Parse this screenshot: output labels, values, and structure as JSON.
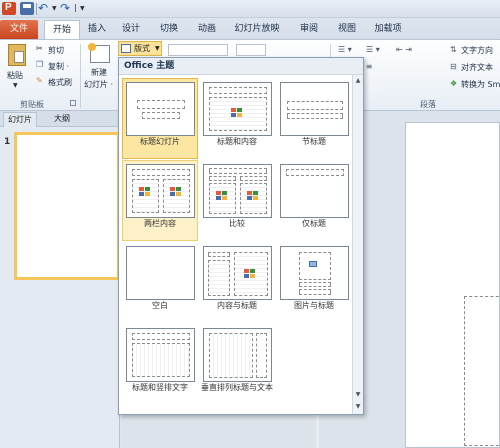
{
  "quick_access": {
    "separator": "|"
  },
  "tabs": [
    "文件",
    "开始",
    "插入",
    "设计",
    "切换",
    "动画",
    "幻灯片放映",
    "审阅",
    "视图",
    "加载项"
  ],
  "ribbon": {
    "paste": "粘贴",
    "cut": "剪切",
    "copy": "复制 ·",
    "format_painter": "格式刷",
    "clipboard_group": "剪贴板",
    "new_slide_line1": "新建",
    "new_slide_line2": "幻灯片 ·",
    "layout_btn": "版式",
    "paragraph_group": "段落",
    "text_direction": "文字方向",
    "align_text": "对齐文本",
    "convert_smartart": "转换为 Sm"
  },
  "thumbs_pane": {
    "tab_slides": "幻灯片",
    "tab_outline": "大纲",
    "slide_number": "1"
  },
  "gallery": {
    "header": "Office 主题",
    "layouts": [
      {
        "label": "标题幻灯片",
        "state": "selected"
      },
      {
        "label": "标题和内容",
        "state": "normal"
      },
      {
        "label": "节标题",
        "state": "normal"
      },
      {
        "label": "两栏内容",
        "state": "hover"
      },
      {
        "label": "比较",
        "state": "normal"
      },
      {
        "label": "仅标题",
        "state": "normal"
      },
      {
        "label": "空白",
        "state": "normal"
      },
      {
        "label": "内容与标题",
        "state": "normal"
      },
      {
        "label": "图片与标题",
        "state": "normal"
      },
      {
        "label": "标题和竖排文字",
        "state": "normal"
      },
      {
        "label": "垂直排列标题与文本",
        "state": "normal"
      }
    ]
  }
}
